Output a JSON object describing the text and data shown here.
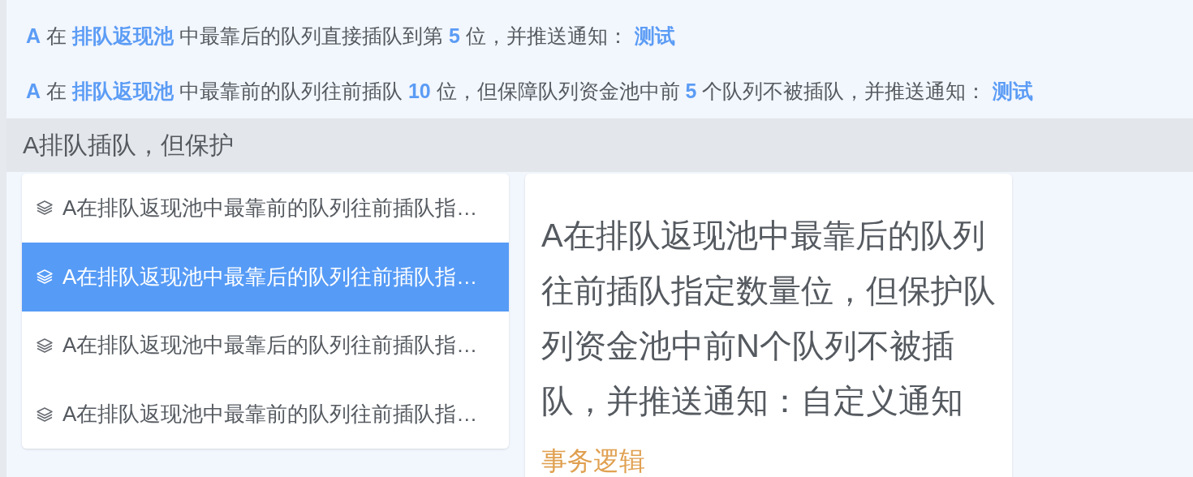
{
  "rules": [
    {
      "text": "**A** 在 **排队返现池** 中最靠后的队列直接插队到第 **5** 位，并推送通知：",
      "link": "测试"
    },
    {
      "text": "**A** 在 **排队返现池** 中最靠前的队列往前插队 **10** 位，但保障队列资金池中前 **5** 个队列不被插队，并推送通知：",
      "link": "测试"
    }
  ],
  "search": {
    "value": "A排队插队，但保护"
  },
  "suggestions": [
    {
      "label": "A在排队返现池中最靠前的队列往前插队指…",
      "selected": false
    },
    {
      "label": "A在排队返现池中最靠后的队列往前插队指…",
      "selected": true
    },
    {
      "label": "A在排队返现池中最靠后的队列往前插队指…",
      "selected": false
    },
    {
      "label": "A在排队返现池中最靠前的队列往前插队指…",
      "selected": false
    }
  ],
  "detail": {
    "title": "A在排队返现池中最靠后的队列往前插队指定数量位，但保护队列资金池中前N个队列不被插队，并推送通知：自定义通知",
    "category": "事务逻辑"
  }
}
